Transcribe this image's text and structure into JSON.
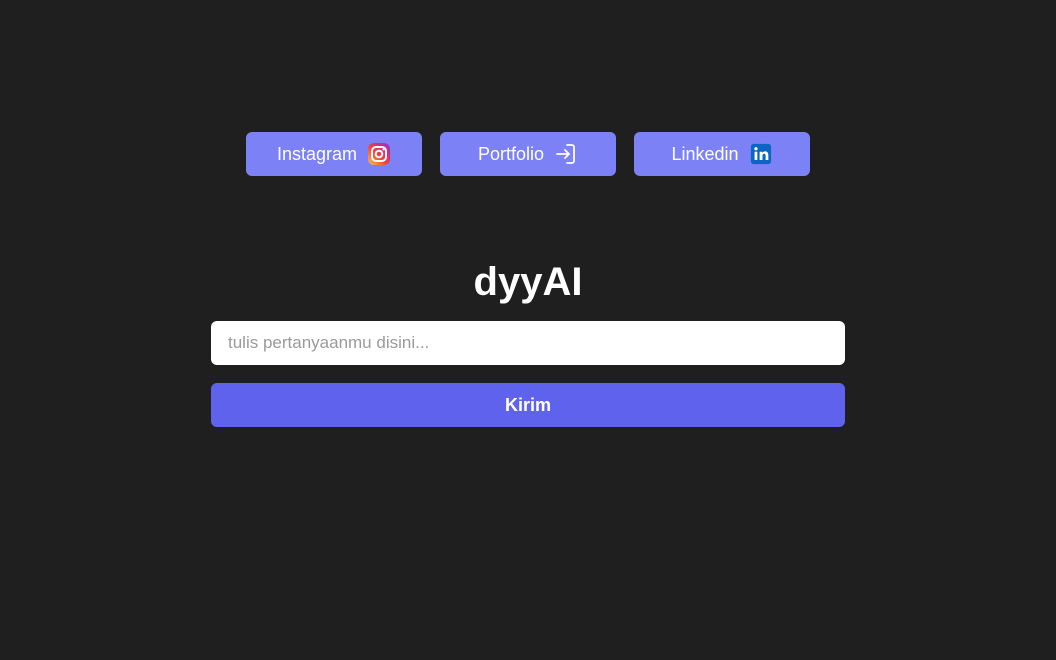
{
  "links": {
    "instagram": {
      "label": "Instagram",
      "icon": "instagram-icon"
    },
    "portfolio": {
      "label": "Portfolio",
      "icon": "login-arrow-icon"
    },
    "linkedin": {
      "label": "Linkedin",
      "icon": "linkedin-icon"
    }
  },
  "app": {
    "title": "dyyAI"
  },
  "chat": {
    "placeholder": "tulis pertanyaanmu disini...",
    "value": "",
    "submit_label": "Kirim"
  },
  "colors": {
    "background": "#1f1f1f",
    "link_button": "#7c82f5",
    "submit_button": "#5e62ec",
    "input_background": "#ffffff",
    "linkedin_blue": "#0a66c2"
  }
}
